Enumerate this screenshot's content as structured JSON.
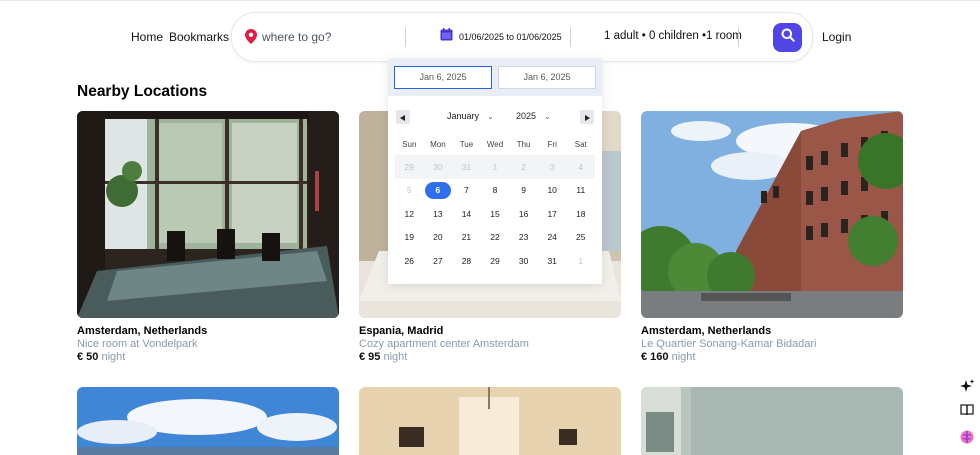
{
  "nav": {
    "home": "Home",
    "bookmarks": "Bookmarks",
    "login": "Login"
  },
  "search": {
    "placeholder": "where to go?",
    "dates": "01/06/2025 to 01/06/2025",
    "guests": "1 adult • 0 children •1 room"
  },
  "calendar": {
    "start_input": "Jan 6, 2025",
    "end_input": "Jan 6, 2025",
    "month": "January",
    "year": "2025",
    "weekdays": [
      "Sun",
      "Mon",
      "Tue",
      "Wed",
      "Thu",
      "Fri",
      "Sat"
    ],
    "weeks": [
      [
        "29",
        "30",
        "31",
        "1",
        "2",
        "3",
        "4"
      ],
      [
        "5",
        "6",
        "7",
        "8",
        "9",
        "10",
        "11"
      ],
      [
        "12",
        "13",
        "14",
        "15",
        "16",
        "17",
        "18"
      ],
      [
        "19",
        "20",
        "21",
        "22",
        "23",
        "24",
        "25"
      ],
      [
        "26",
        "27",
        "28",
        "29",
        "30",
        "31",
        "1"
      ]
    ],
    "selected": "6"
  },
  "section_title": "Nearby Locations",
  "listings": [
    {
      "location": "Amsterdam, Netherlands",
      "name": "Nice room at Vondelpark",
      "price": "€ 50",
      "unit": "night"
    },
    {
      "location": "Espania, Madrid",
      "name": "Cozy apartment center Amsterdam",
      "price": "€ 95",
      "unit": "night"
    },
    {
      "location": "Amsterdam, Netherlands",
      "name": "Le Quartier Sonang-Kamar Bidadari",
      "price": "€ 160",
      "unit": "night"
    }
  ],
  "colors": {
    "accent": "#4f46e5",
    "pin": "#e11d48",
    "selected_day": "#2f6fed",
    "muted_text": "#8a9aae"
  },
  "icons": {
    "location": "map-pin-icon",
    "date": "calendar-icon",
    "search": "search-icon",
    "sparkle": "sparkle-icon",
    "book": "book-icon",
    "brain": "brain-icon"
  }
}
